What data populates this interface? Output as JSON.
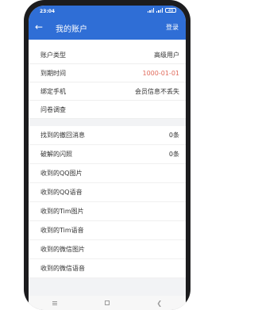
{
  "status_bar": {
    "time": "23:04",
    "battery": "49"
  },
  "header": {
    "back_icon": "arrow-left-icon",
    "title": "我的账户",
    "login_label": "登录"
  },
  "account": [
    {
      "label": "账户类型",
      "value": "高级用户"
    },
    {
      "label": "到期时间",
      "value": "1000-01-01"
    },
    {
      "label": "绑定手机",
      "value": "会员信息不丢失"
    },
    {
      "label": "问卷调查",
      "value": ""
    }
  ],
  "stats": [
    {
      "label": "找到的撤回消息",
      "value": "0条"
    },
    {
      "label": "破解的闪照",
      "value": "0条"
    },
    {
      "label": "收到的QQ图片",
      "value": ""
    },
    {
      "label": "收到的QQ语音",
      "value": ""
    },
    {
      "label": "收到的Tim图片",
      "value": ""
    },
    {
      "label": "收到的Tim语音",
      "value": ""
    },
    {
      "label": "收到的微信图片",
      "value": ""
    },
    {
      "label": "收到的微信语音",
      "value": ""
    }
  ],
  "colors": {
    "accent": "#2f6ed6",
    "date_value": "#e06a5b"
  }
}
